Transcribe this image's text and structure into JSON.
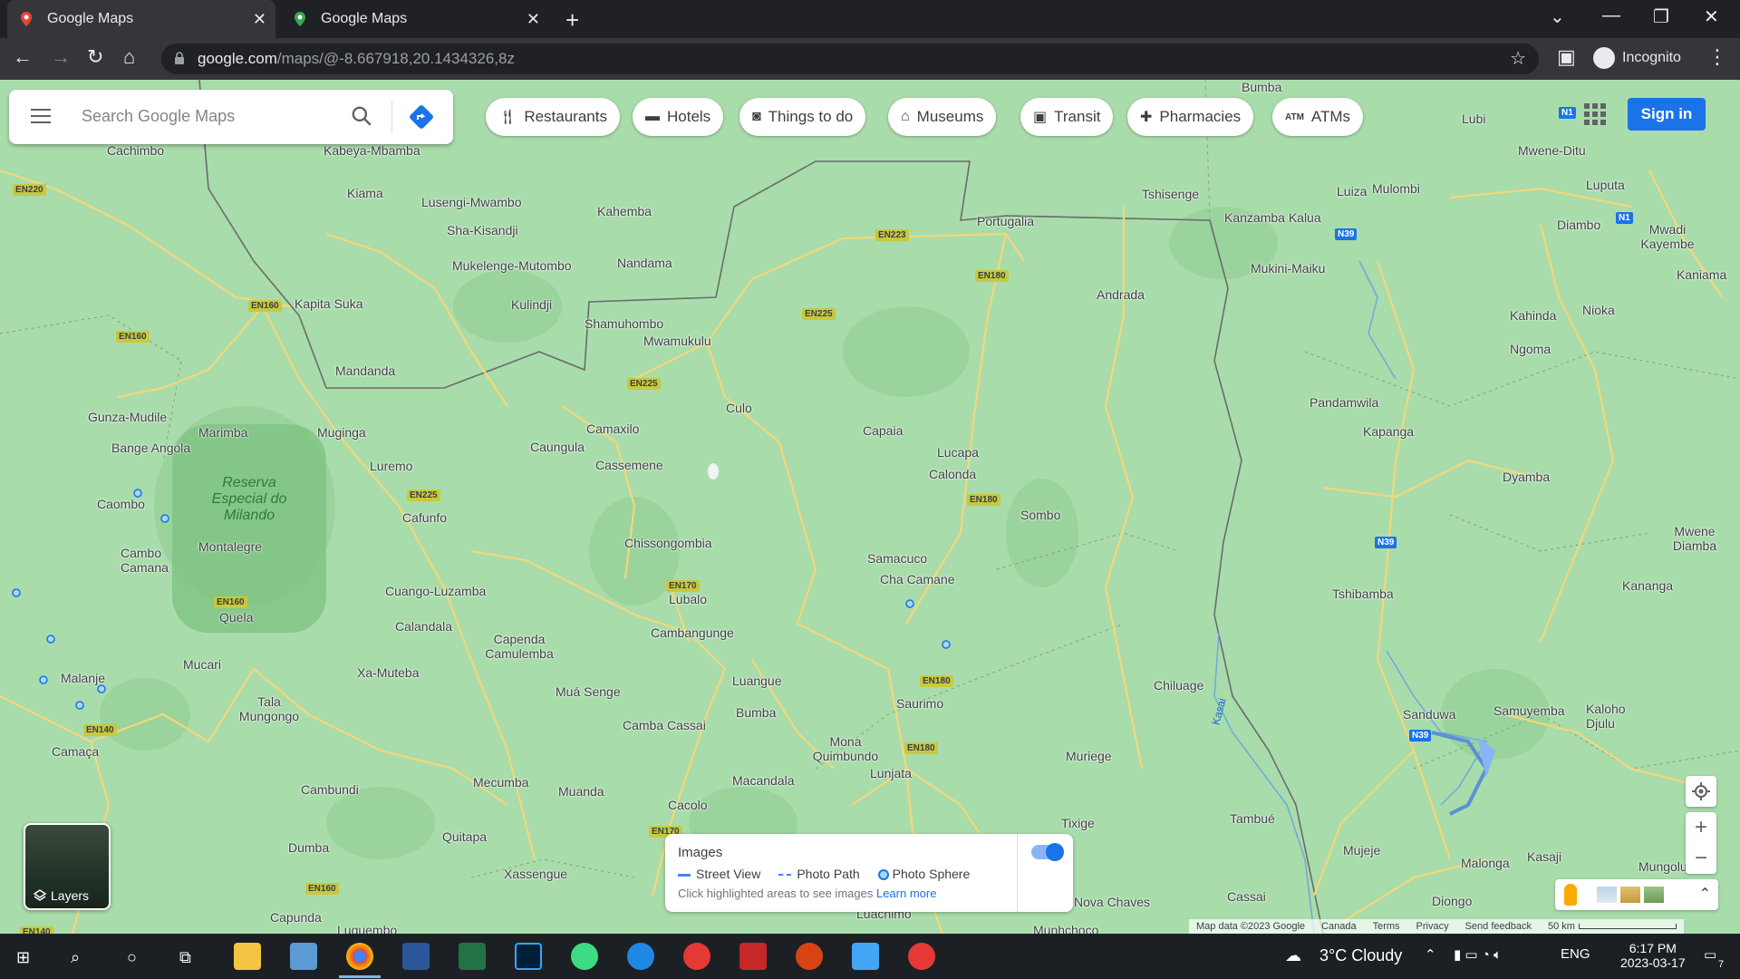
{
  "browser": {
    "tabs": [
      {
        "title": "Google Maps"
      },
      {
        "title": "Google Maps"
      }
    ],
    "url_host": "google.com",
    "url_path": "/maps/@-8.667918,20.1434326,8z",
    "profile": "Incognito"
  },
  "maps": {
    "search_placeholder": "Search Google Maps",
    "chips": [
      {
        "label": "Restaurants",
        "icon": "fork-knife-icon"
      },
      {
        "label": "Hotels",
        "icon": "bed-icon"
      },
      {
        "label": "Things to do",
        "icon": "camera-icon"
      },
      {
        "label": "Museums",
        "icon": "museum-icon"
      },
      {
        "label": "Transit",
        "icon": "train-icon"
      },
      {
        "label": "Pharmacies",
        "icon": "pharmacy-icon"
      },
      {
        "label": "ATMs",
        "icon": "atm-icon"
      }
    ],
    "sign_in": "Sign in",
    "layers_label": "Layers",
    "reserve_name": "Reserva Especial do Milando",
    "river_label": "Kasai",
    "places": [
      "Cachimbo",
      "Kabeya-Mbamba",
      "Kiama",
      "Lusengi-Mwambo",
      "Kahemba",
      "Sha-Kisandji",
      "Nandama",
      "Mukelenge-Mutombo",
      "Kulindji",
      "Kapita Suka",
      "Shamuhombo",
      "Mwamukulu",
      "Mandanda",
      "Gunza-Mudile",
      "Marimba",
      "Muginga",
      "Bange Angola",
      "Camaxilo",
      "Caungula",
      "Cassemene",
      "Culo",
      "Capaia",
      "Lucapa",
      "Calonda",
      "Luremo",
      "Caombo",
      "Cafunfo",
      "Chissongombia",
      "Sombo",
      "Cambo Camana",
      "Montalegre",
      "Samacuco",
      "Cha Camane",
      "Lubalo",
      "Cuango-Luzamba",
      "Quela",
      "Calandala",
      "Cambangunge",
      "Capenda Camulemba",
      "Mucari",
      "Xa-Muteba",
      "Tala Mungongo",
      "Malanje",
      "Luangue",
      "Muá Senge",
      "Bumba",
      "Camba Cassai",
      "Saurimo",
      "Chiluage",
      "Mona Quimbundo",
      "Lunjata",
      "Muriege",
      "Macandala",
      "Cambundi",
      "Mecumba",
      "Muanda",
      "Cacolo",
      "Quitapa",
      "Tixige",
      "Dumba",
      "Xassengue",
      "Camaça",
      "Capunda",
      "Luquembo",
      "Munhchoco",
      "Nova Chaves",
      "Cassai",
      "Luachimo",
      "Portugalia",
      "Andrada",
      "Tshisenge",
      "Kanzamba Kalua",
      "Luiza",
      "Mulombi",
      "Mukini-Maiku",
      "Pandamwila",
      "Kapanga",
      "Tshibamba",
      "Sanduwa",
      "Samuyemba",
      "Kaloho Djulu",
      "Tambué",
      "Mujeje",
      "Malonga",
      "Kasaji",
      "Diongo",
      "Lubi",
      "Mwene-Ditu",
      "Luputa",
      "Diambo",
      "Mwadi Kayembe",
      "Kaniama",
      "Kahinda",
      "Nioka",
      "Ngoma",
      "Dyamba",
      "Mwene Diamba",
      "Kananga",
      "Mungolu",
      "Bumba"
    ],
    "road_labels": [
      "EN220",
      "EN160",
      "EN160",
      "EN223",
      "EN180",
      "EN225",
      "EN225",
      "EN225",
      "EN180",
      "EN170",
      "EN160",
      "EN180",
      "EN180",
      "EN140",
      "EN170",
      "EN160",
      "EN140"
    ],
    "n_labels": [
      "N1",
      "N1",
      "N39",
      "N39",
      "N39"
    ],
    "images_panel": {
      "title": "Images",
      "legend": [
        "Street View",
        "Photo Path",
        "Photo Sphere"
      ],
      "hint": "Click highlighted areas to see images",
      "learn_more": "Learn more",
      "toggle_on": true
    },
    "attribution": [
      "Map data ©2023 Google",
      "Canada",
      "Terms",
      "Privacy",
      "Send feedback",
      "50 km"
    ]
  },
  "taskbar": {
    "weather": "3°C  Cloudy",
    "lang": "ENG",
    "time": "6:17 PM",
    "date": "2023-03-17",
    "notifications": "7"
  },
  "colors": {
    "map_bg": "#a9dcab",
    "accent": "#1a73e8",
    "road": "#f3d77a"
  }
}
